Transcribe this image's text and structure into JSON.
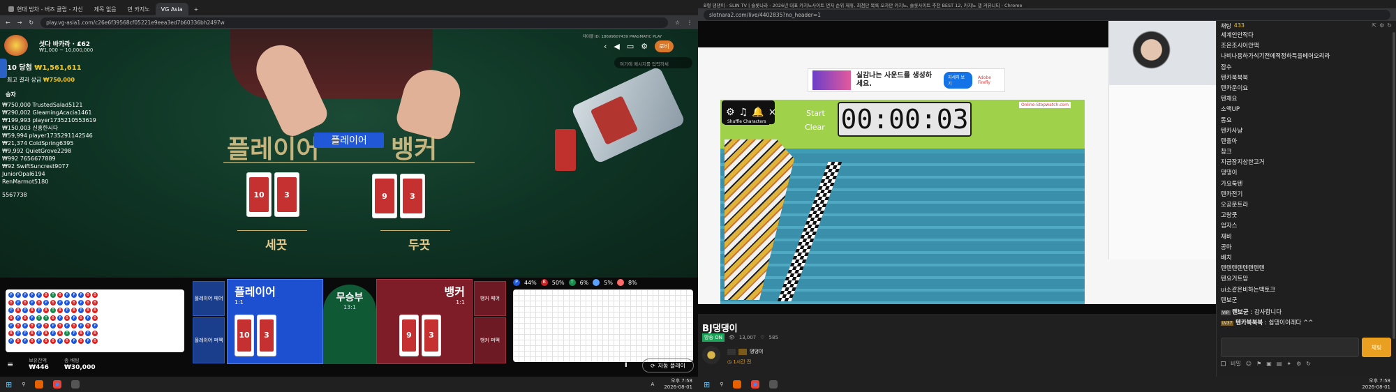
{
  "left_browser": {
    "tabs": [
      "현대 법차 - 버즈 클럽 - 자신",
      "제목 없음",
      "먼 카지노",
      "VG Asia"
    ],
    "url": "play.vg-asia1.com/c26e6f39568cf05221e9eea3ed7b60336bh2497w"
  },
  "game": {
    "table_name": "섯다 바카라 · ₤62",
    "limits": "₩1,000 ~ 10,000,000",
    "win_label": "10 당첨",
    "win_amount": "₩1,561,611",
    "top_win_label": "최고 결과 상금",
    "top_win_amount": "₩750,000",
    "winners_title": "승자",
    "winners": [
      "₩750,000 TrustedSalad5121",
      "₩290,002 GleamingAcacia1461",
      "₩199,993 player1735210553619",
      "₩150,003 신홍한시다",
      "₩59,994 player1735291142546",
      "₩21,374 ColdSpring6395",
      "₩9,992 QuietGrove2298",
      "₩992 7656677889",
      "₩92 SwiftSuncrest9077",
      "JuniorOpal6194",
      "RenMarmot5180",
      "5567738"
    ],
    "chat_placeholder": "여기에 메시지를 입력하세",
    "lobby": "로비",
    "table_id": "테이블 ID: 18699607439 PRAGMATIC PLAY",
    "player_banner": "플레이어",
    "table_title_left": "플레이어",
    "table_title_right": "뱅커",
    "player_result": "세끗",
    "banker_result": "두끗",
    "player_cards": [
      "10",
      "3"
    ],
    "banker_cards": [
      "9",
      "3"
    ],
    "bet_player_label": "플레이어",
    "bet_player_odds": "1:1",
    "bet_tie_label": "무승부",
    "bet_tie_odds": "13:1",
    "bet_banker_label": "뱅커",
    "bet_banker_odds": "1:1",
    "side_pair_p": "플레이어 페어",
    "side_perfect_p": "플레이어 퍼펙",
    "side_pair_b": "뱅커 페어",
    "side_perfect_b": "뱅커 퍼펙",
    "stats": {
      "p_pct": "44%",
      "b_pct": "50%",
      "t_pct": "6%",
      "pp_pct": "5%",
      "bp_pct": "8%"
    },
    "balance_label": "보유잔액",
    "balance": "₩446",
    "total_bet_label": "총 배팅",
    "total_bet": "₩30,000",
    "autoplay": "자동 플레이",
    "bead_road": "PPPPPBTBPPPBB BPBPBPBPPBPBB PBPBPBTBPBPBB BPBPTTBPBPBPB PBPBPBPBPBPBP BPPBPBPBTPBPB PBPBPBBPBPBPB"
  },
  "left_taskbar": {
    "time": "오후 7:58",
    "date": "2026-08-01",
    "lang": "A"
  },
  "right_browser": {
    "title": "B형 댕댕이 - SLIN TV | 슬롯나라 - 2026년 대표 카지노사이트 먼저 순위 제휴, 최첨단 목록 오차만 카지노, 슬롯사이트 추천 BEST 12, 카지노 갤 커뮤니티 - Chrome",
    "url": "slotnara2.com/live/4402835?no_header=1"
  },
  "stream": {
    "ad_text": "실감나는 사운드를 생성하세요.",
    "ad_brand": "Adobe Firefly",
    "ad_button": "자세히 보기",
    "timer": "00:00:03",
    "start": "Start",
    "clear": "Clear",
    "shuffle": "Shuffle Characters",
    "site_mark": "Online-Stopwatch.com",
    "streamer_name": "BJ댕댕이",
    "live_badge": "방송 ON",
    "viewers": "13,007",
    "likes": "585",
    "tag_user": "댕댕이",
    "uptime": "1시간 전"
  },
  "chat": {
    "header": "채팅",
    "count": "433",
    "lines": [
      "세계인안작다",
      "조은조시어안맥",
      "나비나용하가식기전에적정하특을베어오리라",
      "잡수",
      "텐카북북북",
      "텐카운이요",
      "텐채요",
      "소액UP",
      "통요",
      "텐카사냘",
      "텐출아",
      "참크",
      "지금장지상한고거",
      "댕댕이",
      "가요툭텐",
      "텐카전기",
      "오공문트라",
      "고랑쿳",
      "엄자스",
      "재비",
      "공마",
      "배치",
      "텐텐텐텐텐텐텐텐",
      "텐요거트맘",
      "ui소같은비하는백토크",
      "텐보군"
    ],
    "user_msgs": [
      {
        "badge": "VIP",
        "user": "텐보군",
        "text": "감사합니다"
      },
      {
        "badge": "LV37",
        "user": "텐카북북북",
        "text": "쉽댕이이레다 ^^"
      }
    ],
    "send": "채팅",
    "toolbar_label": "비밀"
  },
  "right_taskbar": {
    "time": "오후 7:58",
    "date": "2026-08-01"
  },
  "colors": {
    "felt": "#0e3a28",
    "player_blue": "#1d4fd1",
    "banker_red": "#9e2030",
    "tie_green": "#0f5a34",
    "chat_bg": "#1f1f1f",
    "accent_yellow": "#f5c518"
  }
}
